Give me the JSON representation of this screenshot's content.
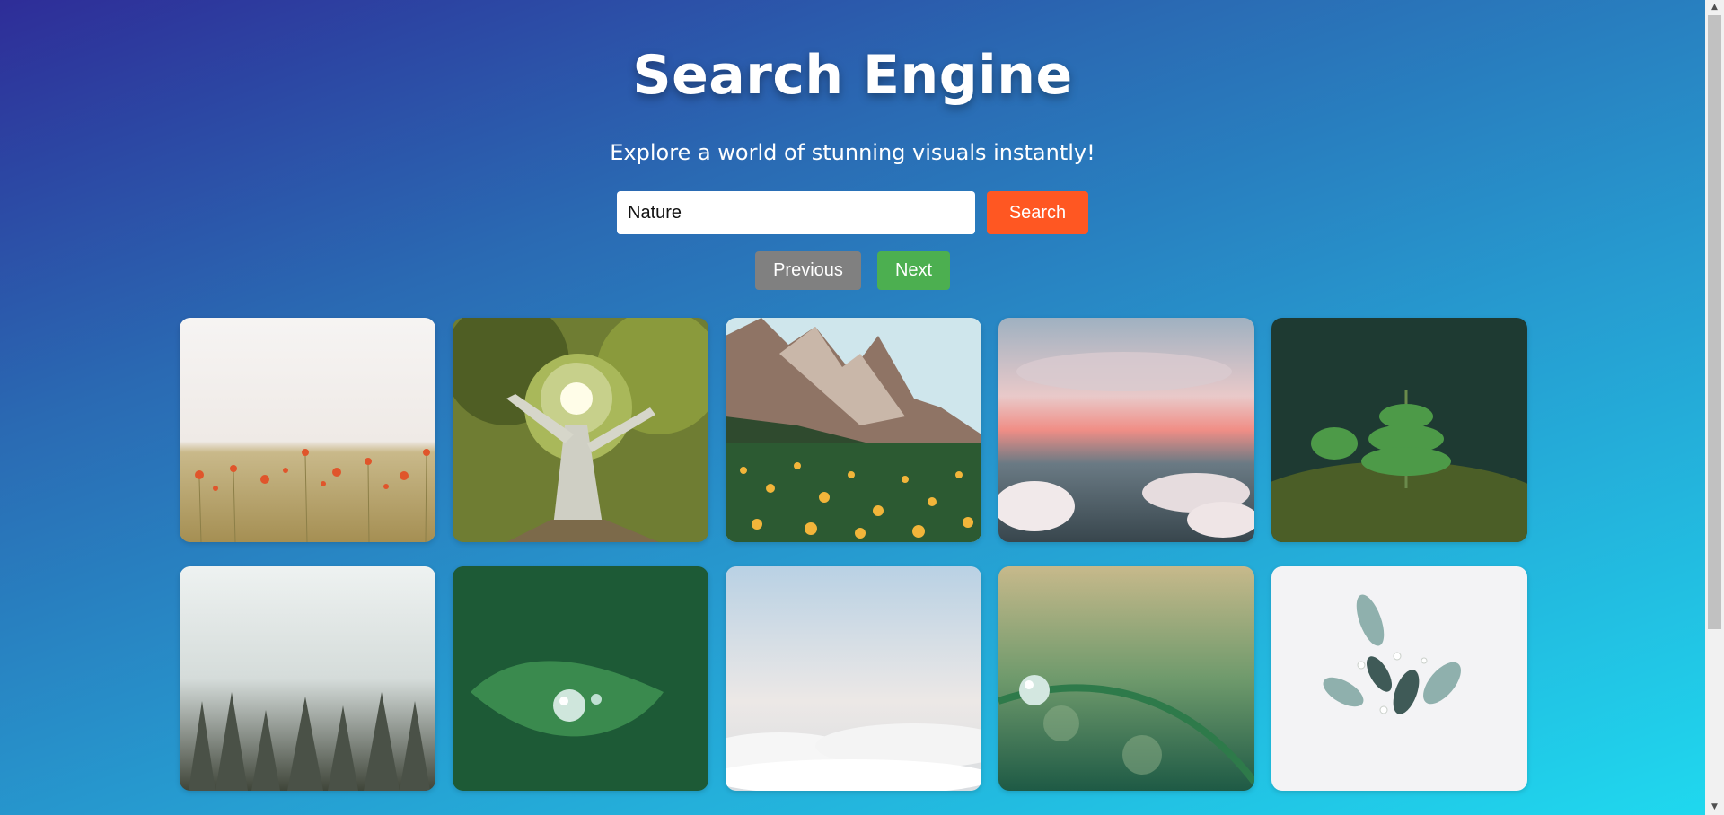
{
  "header": {
    "title": "Search Engine",
    "subtitle": "Explore a world of stunning visuals instantly!"
  },
  "search": {
    "value": "Nature",
    "button_label": "Search"
  },
  "pagination": {
    "previous_label": "Previous",
    "next_label": "Next"
  },
  "colors": {
    "search_button": "#ff5722",
    "previous_button": "#808080",
    "next_button": "#4caf50",
    "gradient_start": "#2e2d98",
    "gradient_end": "#1fd9ef"
  },
  "results": [
    {
      "subject": "red poppies in a wheat field"
    },
    {
      "subject": "large tree canopy with sunlight"
    },
    {
      "subject": "rocky mountain with yellow flower meadow"
    },
    {
      "subject": "pink sky above clouds"
    },
    {
      "subject": "small fir sapling on mossy ground"
    },
    {
      "subject": "misty pine forest"
    },
    {
      "subject": "water droplet on green leaf"
    },
    {
      "subject": "sea of clouds under pale sky"
    },
    {
      "subject": "dew drop on a blade of grass"
    },
    {
      "subject": "white and green flower bouquet"
    }
  ],
  "scrollbar": {
    "up_icon": "scroll-up-arrow-icon",
    "down_icon": "scroll-down-arrow-icon"
  }
}
